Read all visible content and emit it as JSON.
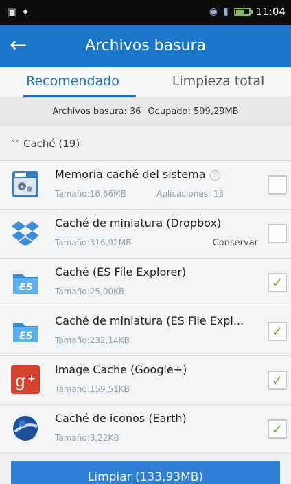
{
  "status": {
    "time": "11:04"
  },
  "header": {
    "title": "Archivos basura"
  },
  "tabs": [
    {
      "label": "Recomendado",
      "active": true
    },
    {
      "label": "Limpieza total",
      "active": false
    }
  ],
  "summary": {
    "junk": "Archivos basura: 36",
    "occupied": "Ocupado: 599,29MB"
  },
  "section": {
    "label": "Caché (19)"
  },
  "items": [
    {
      "title": "Memoria caché del sistema",
      "size": "Tamaño:16,66MB",
      "extra": "Aplicaciones: 13",
      "checked": false,
      "icon": "system-cache-icon"
    },
    {
      "title": "Caché de miniatura (Dropbox)",
      "size": "Tamaño:316,92MB",
      "right": "Conservar",
      "checked": false,
      "icon": "dropbox-icon"
    },
    {
      "title": "Caché (ES File Explorer)",
      "size": "Tamaño:25,00KB",
      "checked": true,
      "icon": "es-file-explorer-icon"
    },
    {
      "title": "Caché de miniatura (ES File Expl...",
      "size": "Tamaño:232,14KB",
      "checked": true,
      "icon": "es-file-explorer-icon"
    },
    {
      "title": "Image Cache (Google+)",
      "size": "Tamaño:159,51KB",
      "checked": true,
      "icon": "google-plus-icon"
    },
    {
      "title": "Caché de iconos (Earth)",
      "size": "Tamaño:8,22KB",
      "checked": true,
      "icon": "google-earth-icon"
    }
  ],
  "button": {
    "label": "Limpiar (133,93MB)"
  },
  "colors": {
    "appbar": "#1976c9",
    "accent": "#1b74c6",
    "check": "#6bb13a",
    "button": "#2f7fd4"
  }
}
